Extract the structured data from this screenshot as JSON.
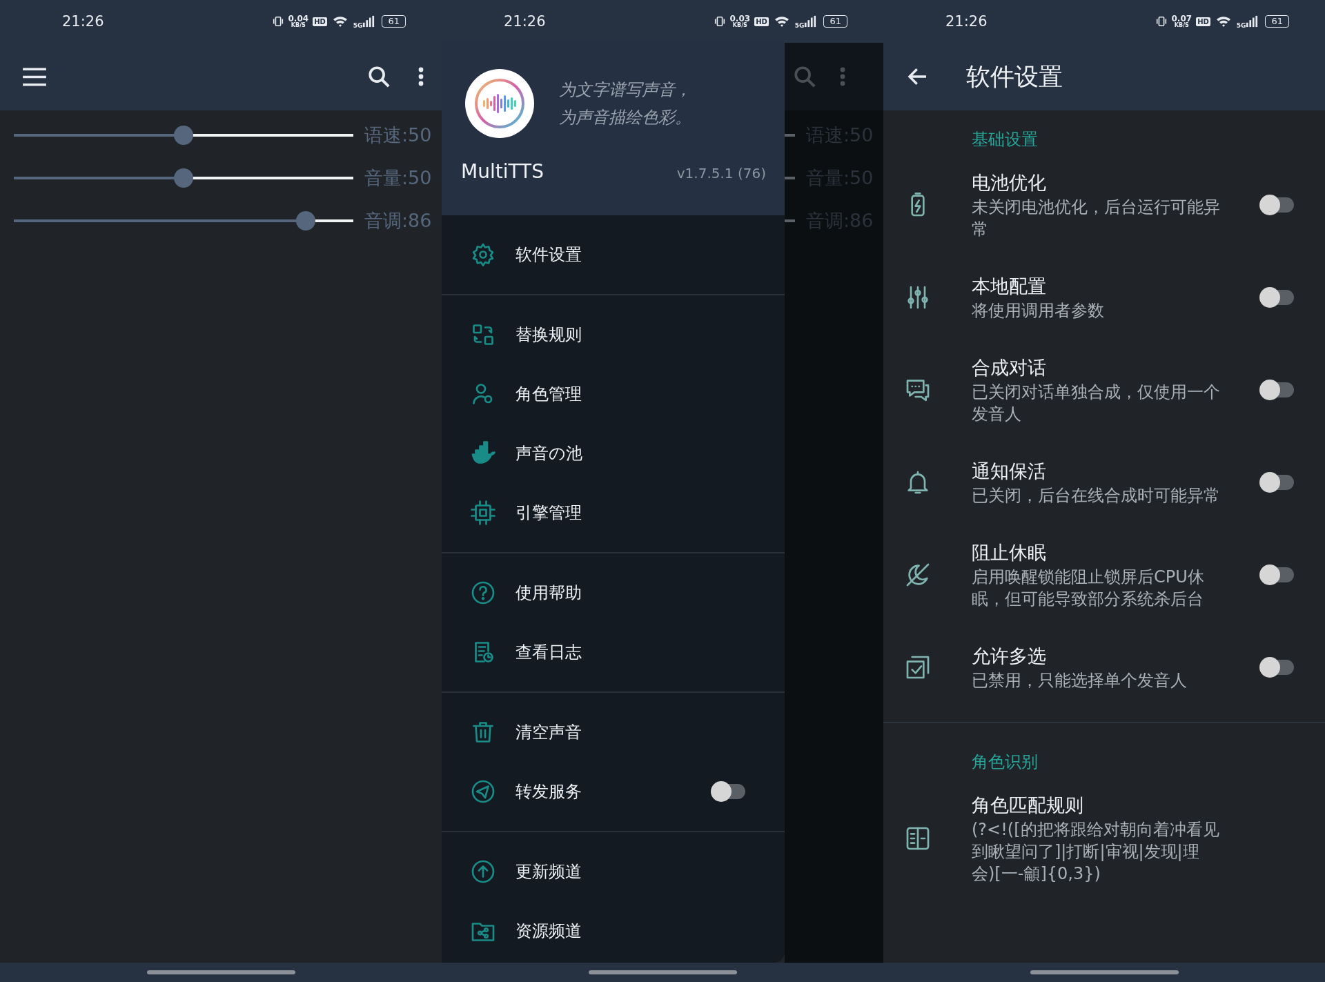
{
  "screens": [
    {
      "kind": "main",
      "status_bar": {
        "time": "21:26",
        "speed": "0.04",
        "speed_unit": "KB/S",
        "hd": "HD",
        "network": "5G",
        "battery": "61"
      },
      "sliders": [
        {
          "label": "语速:50",
          "level": 0.5
        },
        {
          "label": "音量:50",
          "level": 0.5
        },
        {
          "label": "音调:86",
          "level": 0.86
        }
      ]
    },
    {
      "kind": "drawer",
      "status_bar": {
        "time": "21:26",
        "speed": "0.03",
        "speed_unit": "KB/S",
        "hd": "HD",
        "network": "5G",
        "battery": "61"
      },
      "drawer": {
        "tagline": [
          "为文字谱写声音，",
          "为声音描绘色彩。"
        ],
        "app_name": "MultiTTS",
        "version": "v1.7.5.1 (76)",
        "groups": [
          [
            {
              "kind": "link",
              "label": "软件设置"
            }
          ],
          [
            {
              "kind": "link",
              "label": "替换规则"
            },
            {
              "kind": "link",
              "label": "角色管理"
            },
            {
              "kind": "link",
              "label": "声音の池"
            },
            {
              "kind": "link",
              "label": "引擎管理"
            }
          ],
          [
            {
              "kind": "link",
              "label": "使用帮助"
            },
            {
              "kind": "link",
              "label": "查看日志"
            }
          ],
          [
            {
              "kind": "link",
              "label": "清空声音"
            },
            {
              "kind": "toggle",
              "label": "转发服务",
              "on": false
            }
          ],
          [
            {
              "kind": "link",
              "label": "更新频道"
            },
            {
              "kind": "link",
              "label": "资源频道"
            }
          ]
        ]
      },
      "behind": [
        "语速:50",
        "音量:50",
        "音调:86"
      ]
    },
    {
      "kind": "settings",
      "status_bar": {
        "time": "21:26",
        "speed": "0.07",
        "speed_unit": "KB/S",
        "hd": "HD",
        "network": "5G",
        "battery": "61"
      },
      "title": "软件设置",
      "sections": [
        {
          "title": "基础设置",
          "items": [
            {
              "kind": "toggle",
              "title": "电池优化",
              "subtitle": "未关闭电池优化，后台运行可能异常",
              "on": false
            },
            {
              "kind": "toggle",
              "title": "本地配置",
              "subtitle": "将使用调用者参数",
              "on": false
            },
            {
              "kind": "toggle",
              "title": "合成对话",
              "subtitle": "已关闭对话单独合成，仅使用一个发音人",
              "on": false
            },
            {
              "kind": "toggle",
              "title": "通知保活",
              "subtitle": "已关闭，后台在线合成时可能异常",
              "on": false
            },
            {
              "kind": "toggle",
              "title": "阻止休眠",
              "subtitle": "启用唤醒锁能阻止锁屏后CPU休眠，但可能导致部分系统杀后台",
              "on": false
            },
            {
              "kind": "toggle",
              "title": "允许多选",
              "subtitle": "已禁用，只能选择单个发音人",
              "on": false
            }
          ]
        },
        {
          "title": "角色识别",
          "items": [
            {
              "kind": "text",
              "title": "角色匹配规则",
              "subtitle": "(?<!([的把将跟给对朝向着冲看见到瞅望问了]|打断|审视|发现|理会)[一-龥]{0,3})"
            }
          ]
        }
      ]
    }
  ]
}
